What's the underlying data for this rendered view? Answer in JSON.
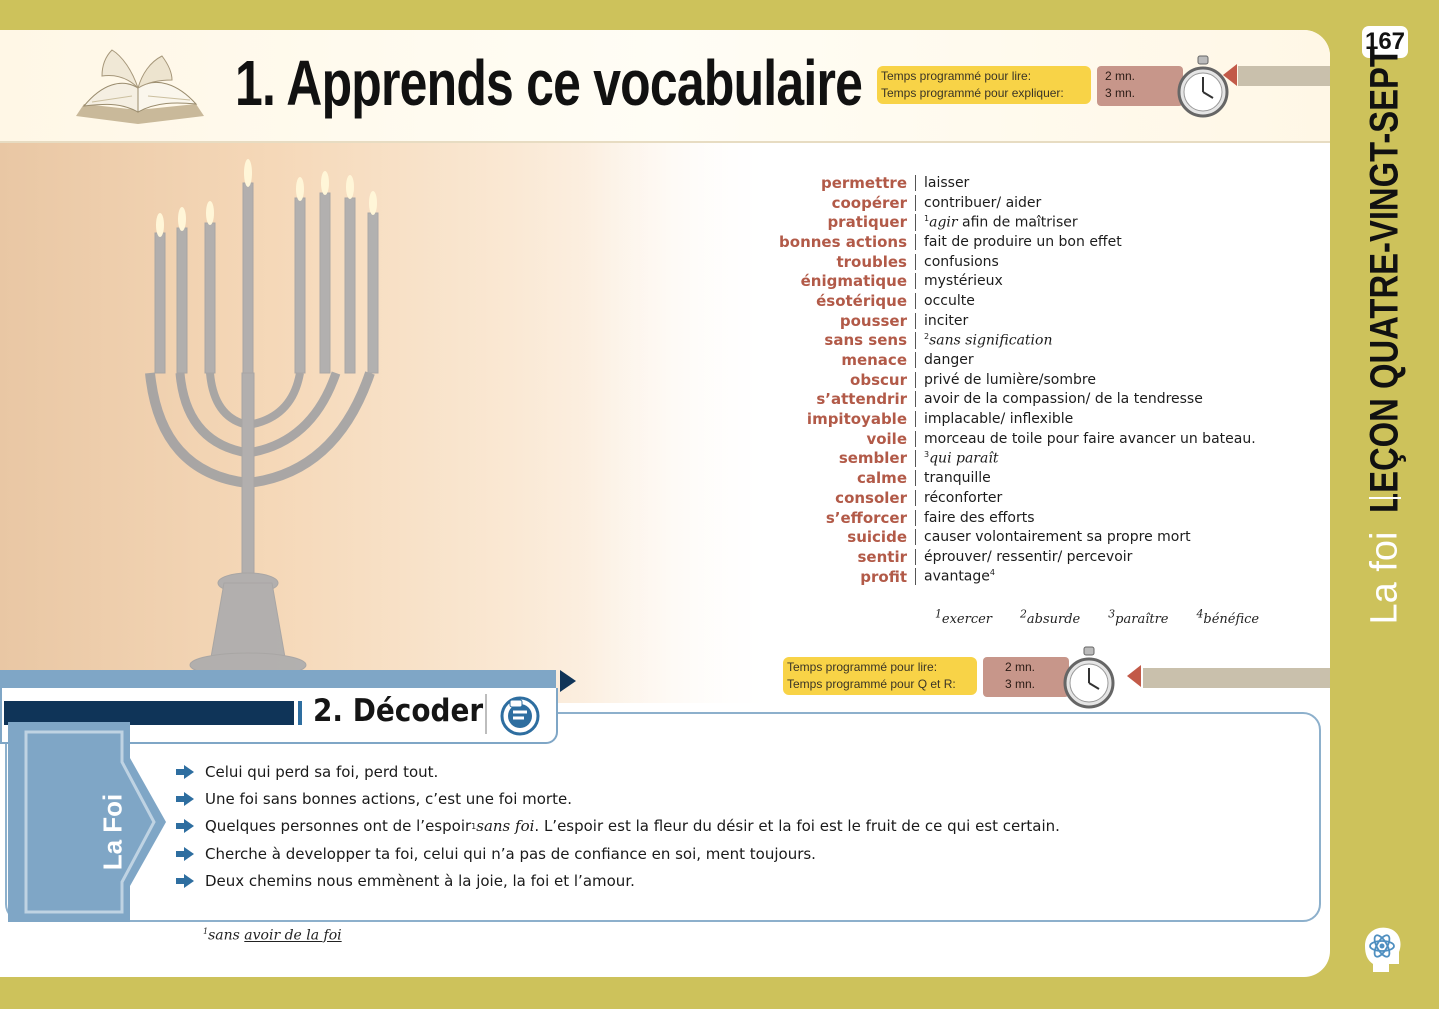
{
  "page_number": "167",
  "lesson_title": "LEÇON QUATRE-VINGT-SEPT",
  "theme_title": "La foi",
  "section1": {
    "title": "1. Apprends ce vocabulaire",
    "timer": {
      "label_read": "Temps programmé pour lire:",
      "label_explain": "Temps programmé pour expliquer:",
      "value_read": "2 mn.",
      "value_explain": "3 mn."
    },
    "vocab": [
      {
        "term": "permettre",
        "def": "laisser"
      },
      {
        "term": "coopérer",
        "def": "contribuer/ aider"
      },
      {
        "term": "pratiquer",
        "sup": "1",
        "def_italic": "agir",
        "def": " afin de maîtriser"
      },
      {
        "term": "bonnes actions",
        "def": "fait de produire un bon effet"
      },
      {
        "term": "troubles",
        "def": "confusions"
      },
      {
        "term": "énigmatique",
        "def": "mystérieux"
      },
      {
        "term": "ésotérique",
        "def": "occulte"
      },
      {
        "term": "pousser",
        "def": "inciter"
      },
      {
        "term": "sans sens",
        "sup": "2",
        "def_italic": "sans signification",
        "def": ""
      },
      {
        "term": "menace",
        "def": "danger"
      },
      {
        "term": "obscur",
        "def": "privé de lumière/sombre"
      },
      {
        "term": "s’attendrir",
        "def": "avoir de la compassion/ de la tendresse"
      },
      {
        "term": "impitoyable",
        "def": "implacable/ inflexible"
      },
      {
        "term": "voile",
        "def": "morceau de toile pour faire avancer un bateau."
      },
      {
        "term": "sembler",
        "sup": "3",
        "def_italic": "qui paraît",
        "def": ""
      },
      {
        "term": "calme",
        "def": "tranquille"
      },
      {
        "term": "consoler",
        "def": "réconforter"
      },
      {
        "term": "s’efforcer",
        "def": "faire des efforts"
      },
      {
        "term": "suicide",
        "def": "causer volontairement sa propre mort"
      },
      {
        "term": "sentir",
        "def": "éprouver/ ressentir/ percevoir"
      },
      {
        "term": "profit",
        "def": "avantage",
        "sup_after": "4"
      }
    ],
    "notes": [
      {
        "n": "1",
        "word": "exercer"
      },
      {
        "n": "2",
        "word": "absurde"
      },
      {
        "n": "3",
        "word": "paraître"
      },
      {
        "n": "4",
        "word": "bénéfice"
      }
    ]
  },
  "section2": {
    "title": "2. Décoder",
    "timer": {
      "label_read": "Temps programmé pour lire:",
      "label_qr": "Temps programmé pour Q et R:",
      "value_read": "2 mn.",
      "value_qr": "3 mn."
    },
    "side_label": "La Foi",
    "lines": [
      {
        "text": "Celui qui perd sa foi, perd tout."
      },
      {
        "text": "Une foi sans bonnes actions, c’est une foi morte."
      },
      {
        "pre": "Quelques personnes ont de l’espoir ",
        "sup": "1",
        "italic": "sans foi",
        "post": ". L’espoir est la fleur du désir et la foi est le fruit de ce qui est certain."
      },
      {
        "text": "Cherche à developper ta foi, celui qui n’a pas de confiance en soi, ment toujours."
      },
      {
        "text": "Deux chemins nous emmènent à la joie, la foi et l’amour."
      }
    ],
    "footnote": {
      "n": "1",
      "pre": "sans ",
      "underlined": "avoir de la foi"
    }
  },
  "colors": {
    "outer_background": "#cdc25b",
    "term_color": "#b25a48",
    "timer_label_bg": "#f8d347",
    "timer_value_bg": "#c7968a",
    "section2_dark_bar": "#0f3458",
    "section2_accent": "#7fa6c6"
  },
  "icons": [
    "open-book-icon",
    "stopwatch-icon",
    "decoder-logo-icon",
    "arrow-bullet-icon",
    "brain-atom-icon",
    "menorah-image"
  ]
}
